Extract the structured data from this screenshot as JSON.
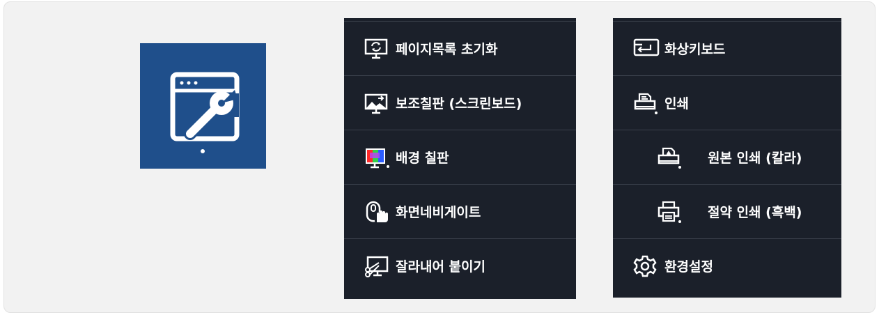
{
  "toolbox_icon": {
    "name": "window-wrench-icon",
    "color": "#1f4f8b"
  },
  "left_menu": {
    "items": [
      {
        "label": "페이지목록 초기화",
        "icon": "monitor-refresh-icon"
      },
      {
        "label": "보조칠판 (스크린보드)",
        "icon": "screenboard-icon"
      },
      {
        "label": "배경 칠판",
        "icon": "color-board-icon"
      },
      {
        "label": "화면네비게이트",
        "icon": "mouse-hand-icon"
      },
      {
        "label": "잘라내어 붙이기",
        "icon": "cut-paste-icon"
      }
    ]
  },
  "right_menu": {
    "items": [
      {
        "label": "화상키보드",
        "icon": "keyboard-enter-icon"
      },
      {
        "label": "인쇄",
        "icon": "printer-icon"
      },
      {
        "label": "원본 인쇄 (칼라)",
        "icon": "color-printer-icon"
      },
      {
        "label": "절약 인쇄 (흑백)",
        "icon": "mono-printer-icon"
      },
      {
        "label": "환경설정",
        "icon": "gear-icon"
      }
    ]
  },
  "colors": {
    "menu_bg": "#1b202a",
    "divider": "#3a404b",
    "page_bg": "#f2f2f2"
  }
}
